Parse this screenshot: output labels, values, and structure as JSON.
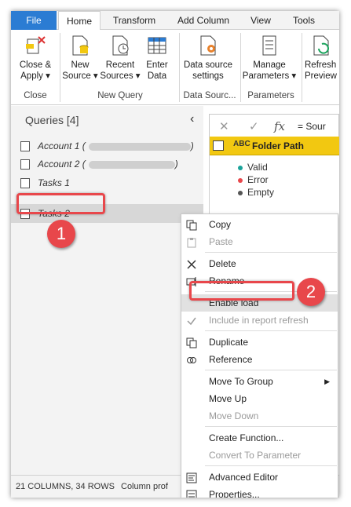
{
  "tabs": [
    {
      "label": "File"
    },
    {
      "label": "Home"
    },
    {
      "label": "Transform"
    },
    {
      "label": "Add Column"
    },
    {
      "label": "View"
    },
    {
      "label": "Tools"
    }
  ],
  "ribbon": {
    "close_apply": {
      "line1": "Close &",
      "line2": "Apply ▾"
    },
    "new_source": {
      "line1": "New",
      "line2": "Source ▾"
    },
    "recent_sources": {
      "line1": "Recent",
      "line2": "Sources ▾"
    },
    "enter_data": {
      "line1": "Enter",
      "line2": "Data"
    },
    "data_source_settings": {
      "line1": "Data source",
      "line2": "settings"
    },
    "manage_parameters": {
      "line1": "Manage",
      "line2": "Parameters ▾"
    },
    "refresh_preview": {
      "line1": "Refresh",
      "line2": "Preview"
    },
    "groups": {
      "close": "Close",
      "new_query": "New Query",
      "data_sources": "Data Sourc...",
      "parameters": "Parameters"
    }
  },
  "queries": {
    "header": "Queries [4]",
    "items": [
      {
        "label": "Account 1 ("
      },
      {
        "label": "Account 2 ("
      },
      {
        "label": "Tasks 1"
      },
      {
        "label": "Tasks 2"
      }
    ],
    "account1_suffix": ")",
    "account2_suffix": ")"
  },
  "formula": {
    "cancel": "✕",
    "commit": "✓",
    "fx": "fx",
    "text": "= Sour"
  },
  "column": {
    "type_label": "ABC",
    "name": "Folder Path",
    "profile": [
      {
        "label": "Valid",
        "color": "#1aa39a"
      },
      {
        "label": "Error",
        "color": "#e8474b"
      },
      {
        "label": "Empty",
        "color": "#555555"
      }
    ]
  },
  "status_bar": {
    "left": "21 COLUMNS, 34 ROWS",
    "middle": "Column prof"
  },
  "context_menu": {
    "copy": "Copy",
    "paste": "Paste",
    "delete": "Delete",
    "rename": "Rename",
    "enable_load": "Enable load",
    "include_refresh": "Include in report refresh",
    "duplicate": "Duplicate",
    "reference": "Reference",
    "move_to_group": "Move To Group",
    "move_up": "Move Up",
    "move_down": "Move Down",
    "create_function": "Create Function...",
    "convert_parameter": "Convert To Parameter",
    "advanced_editor": "Advanced Editor",
    "properties": "Properties..."
  },
  "annotations": {
    "step1": "1",
    "step2": "2"
  },
  "colors": {
    "accent": "#2b7cd3",
    "highlight": "#e8474b",
    "column_header": "#f2c811"
  }
}
